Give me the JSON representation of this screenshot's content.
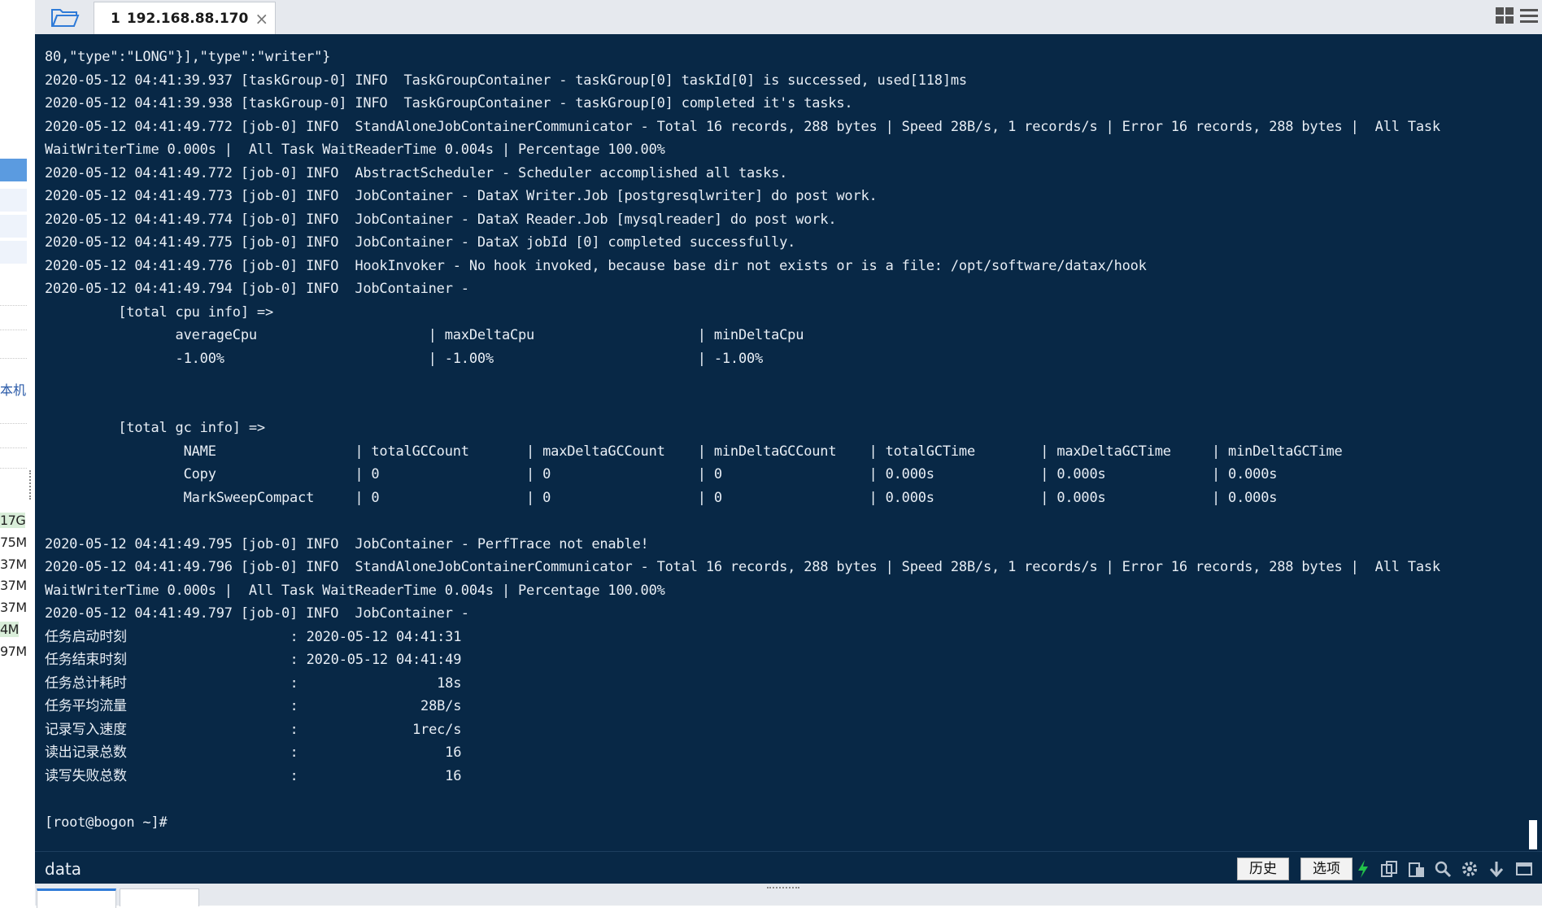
{
  "tab": {
    "number": "1",
    "title": "192.168.88.170"
  },
  "left_panel": {
    "label": "本机",
    "memory_items": [
      "17G",
      "75M",
      "37M",
      "37M",
      "37M",
      "4M",
      "97M"
    ]
  },
  "terminal": {
    "lines": [
      "80,\"type\":\"LONG\"}],\"type\":\"writer\"}",
      "2020-05-12 04:41:39.937 [taskGroup-0] INFO  TaskGroupContainer - taskGroup[0] taskId[0] is successed, used[118]ms",
      "2020-05-12 04:41:39.938 [taskGroup-0] INFO  TaskGroupContainer - taskGroup[0] completed it's tasks.",
      "2020-05-12 04:41:49.772 [job-0] INFO  StandAloneJobContainerCommunicator - Total 16 records, 288 bytes | Speed 28B/s, 1 records/s | Error 16 records, 288 bytes |  All Task",
      "WaitWriterTime 0.000s |  All Task WaitReaderTime 0.004s | Percentage 100.00%",
      "2020-05-12 04:41:49.772 [job-0] INFO  AbstractScheduler - Scheduler accomplished all tasks.",
      "2020-05-12 04:41:49.773 [job-0] INFO  JobContainer - DataX Writer.Job [postgresqlwriter] do post work.",
      "2020-05-12 04:41:49.774 [job-0] INFO  JobContainer - DataX Reader.Job [mysqlreader] do post work.",
      "2020-05-12 04:41:49.775 [job-0] INFO  JobContainer - DataX jobId [0] completed successfully.",
      "2020-05-12 04:41:49.776 [job-0] INFO  HookInvoker - No hook invoked, because base dir not exists or is a file: /opt/software/datax/hook",
      "2020-05-12 04:41:49.794 [job-0] INFO  JobContainer -",
      "         [total cpu info] =>",
      "                averageCpu                     | maxDeltaCpu                    | minDeltaCpu",
      "                -1.00%                         | -1.00%                         | -1.00%",
      "",
      "",
      "         [total gc info] =>",
      "                 NAME                 | totalGCCount       | maxDeltaGCCount    | minDeltaGCCount    | totalGCTime        | maxDeltaGCTime     | minDeltaGCTime",
      "                 Copy                 | 0                  | 0                  | 0                  | 0.000s             | 0.000s             | 0.000s",
      "                 MarkSweepCompact     | 0                  | 0                  | 0                  | 0.000s             | 0.000s             | 0.000s",
      "",
      "2020-05-12 04:41:49.795 [job-0] INFO  JobContainer - PerfTrace not enable!",
      "2020-05-12 04:41:49.796 [job-0] INFO  StandAloneJobContainerCommunicator - Total 16 records, 288 bytes | Speed 28B/s, 1 records/s | Error 16 records, 288 bytes |  All Task",
      "WaitWriterTime 0.000s |  All Task WaitReaderTime 0.004s | Percentage 100.00%",
      "2020-05-12 04:41:49.797 [job-0] INFO  JobContainer -",
      "任务启动时刻                    : 2020-05-12 04:41:31",
      "任务结束时刻                    : 2020-05-12 04:41:49",
      "任务总计耗时                    :                 18s",
      "任务平均流量                    :               28B/s",
      "记录写入速度                    :              1rec/s",
      "读出记录总数                    :                  16",
      "读写失败总数                    :                  16",
      "",
      "[root@bogon ~]#"
    ]
  },
  "statusbar": {
    "session_name": "data",
    "history_label": "历史",
    "options_label": "选项"
  },
  "colors": {
    "terminal_bg": "#082846",
    "terminal_fg": "#e8eef5",
    "tab_status": "#22b14c",
    "accent": "#2f7bd8"
  }
}
